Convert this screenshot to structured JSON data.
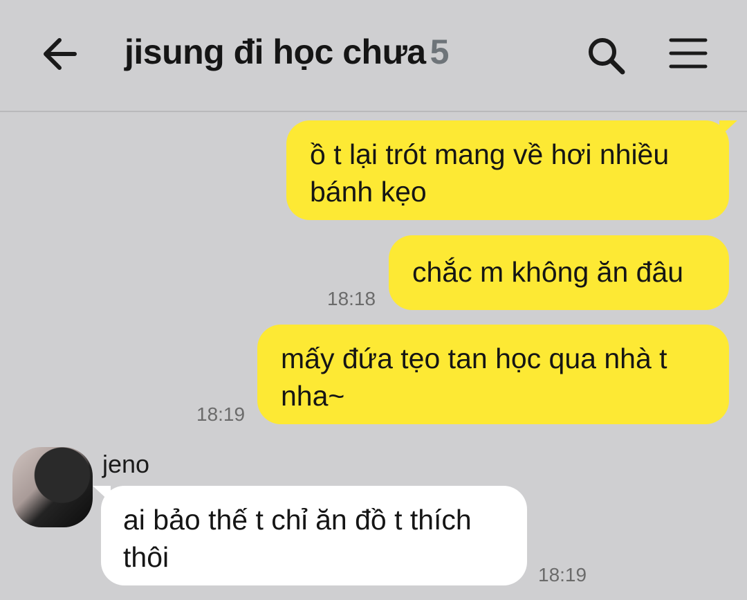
{
  "header": {
    "title": "jisung đi học chưa",
    "member_count": "5",
    "back_icon": "arrow-left-icon",
    "search_icon": "search-icon",
    "menu_icon": "menu-icon"
  },
  "messages": [
    {
      "from": "me",
      "text_lines": [
        "ồ t lại trót mang về hơi nhiều",
        "bánh kẹo"
      ]
    },
    {
      "from": "me",
      "text_lines": [
        "chắc m không ăn đâu"
      ],
      "time": "18:18"
    },
    {
      "from": "me",
      "text_lines": [
        "mấy đứa tẹo tan học qua nhà t",
        "nha~"
      ],
      "time": "18:19"
    },
    {
      "from": "jeno",
      "sender": "jeno",
      "text_lines": [
        "ai bảo thế t chỉ ăn đồ t thích",
        "thôi"
      ],
      "time": "18:19"
    }
  ],
  "colors": {
    "background": "#cfcfd1",
    "my_bubble": "#fde934",
    "their_bubble": "#ffffff"
  }
}
